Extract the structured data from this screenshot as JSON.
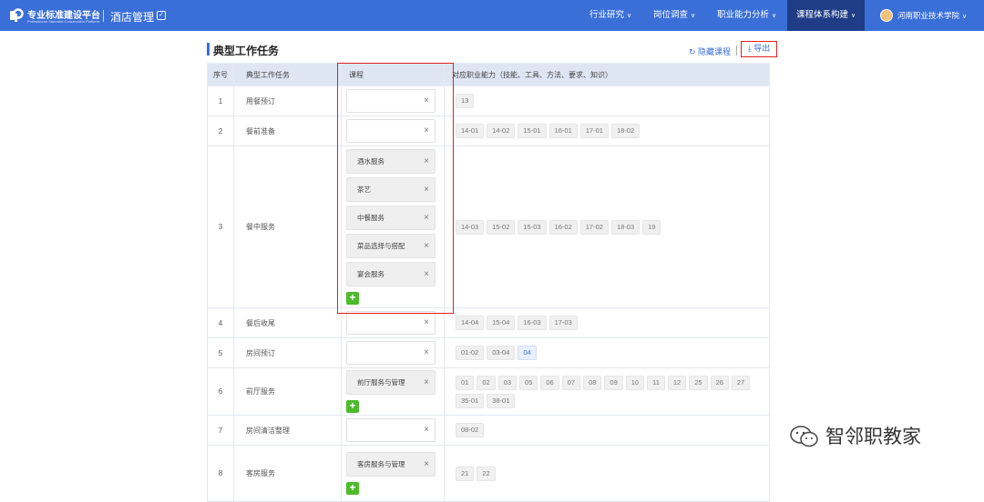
{
  "header": {
    "brand": "专业标准建设平台",
    "brand_sub": "Professional Standard Construction Platform",
    "module": "酒店管理",
    "nav": [
      "行业研究",
      "岗位调查",
      "职业能力分析",
      "课程体系构建"
    ],
    "user": "河南职业技术学院"
  },
  "page": {
    "title": "典型工作任务",
    "hide_courses": "隐藏课程",
    "export": "导出"
  },
  "table": {
    "headers": [
      "序号",
      "典型工作任务",
      "课程",
      "对应职业能力（技能、工具、方法、要求、知识）"
    ],
    "rows": [
      {
        "no": "1",
        "task": "用餐预订",
        "courses": [],
        "abilities": [
          "13"
        ]
      },
      {
        "no": "2",
        "task": "餐前准备",
        "courses": [],
        "abilities": [
          "14-01",
          "14-02",
          "15-01",
          "16-01",
          "17-01",
          "18-02"
        ]
      },
      {
        "no": "3",
        "task": "餐中服务",
        "courses": [
          "酒水服务",
          "茶艺",
          "中餐服务",
          "菜品选择与搭配",
          "宴会服务"
        ],
        "abilities": [
          "14-03",
          "15-02",
          "15-03",
          "16-02",
          "17-02",
          "18-03",
          "19"
        ]
      },
      {
        "no": "4",
        "task": "餐后收尾",
        "courses": [],
        "abilities": [
          "14-04",
          "15-04",
          "16-03",
          "17-03"
        ]
      },
      {
        "no": "5",
        "task": "房间预订",
        "courses": [],
        "abilities": [
          "01-02",
          "03-04",
          "04"
        ]
      },
      {
        "no": "6",
        "task": "前厅服务",
        "courses": [
          "前厅服务与管理"
        ],
        "abilities": [
          "01",
          "02",
          "03",
          "05",
          "06",
          "07",
          "08",
          "09",
          "10",
          "11",
          "12",
          "25",
          "26",
          "27",
          "35-01",
          "38-01"
        ]
      },
      {
        "no": "7",
        "task": "房间清洁整理",
        "courses": [],
        "abilities": [
          "08-02"
        ]
      },
      {
        "no": "8",
        "task": "客房服务",
        "courses": [
          "客房服务与管理"
        ],
        "abilities": [
          "21",
          "22"
        ]
      }
    ]
  },
  "watermark": "智邻职教家",
  "colors": {
    "primary": "#3a6fd8",
    "nav_active": "#1f3c86",
    "highlight": "#e02020",
    "add": "#4cbb2a"
  }
}
